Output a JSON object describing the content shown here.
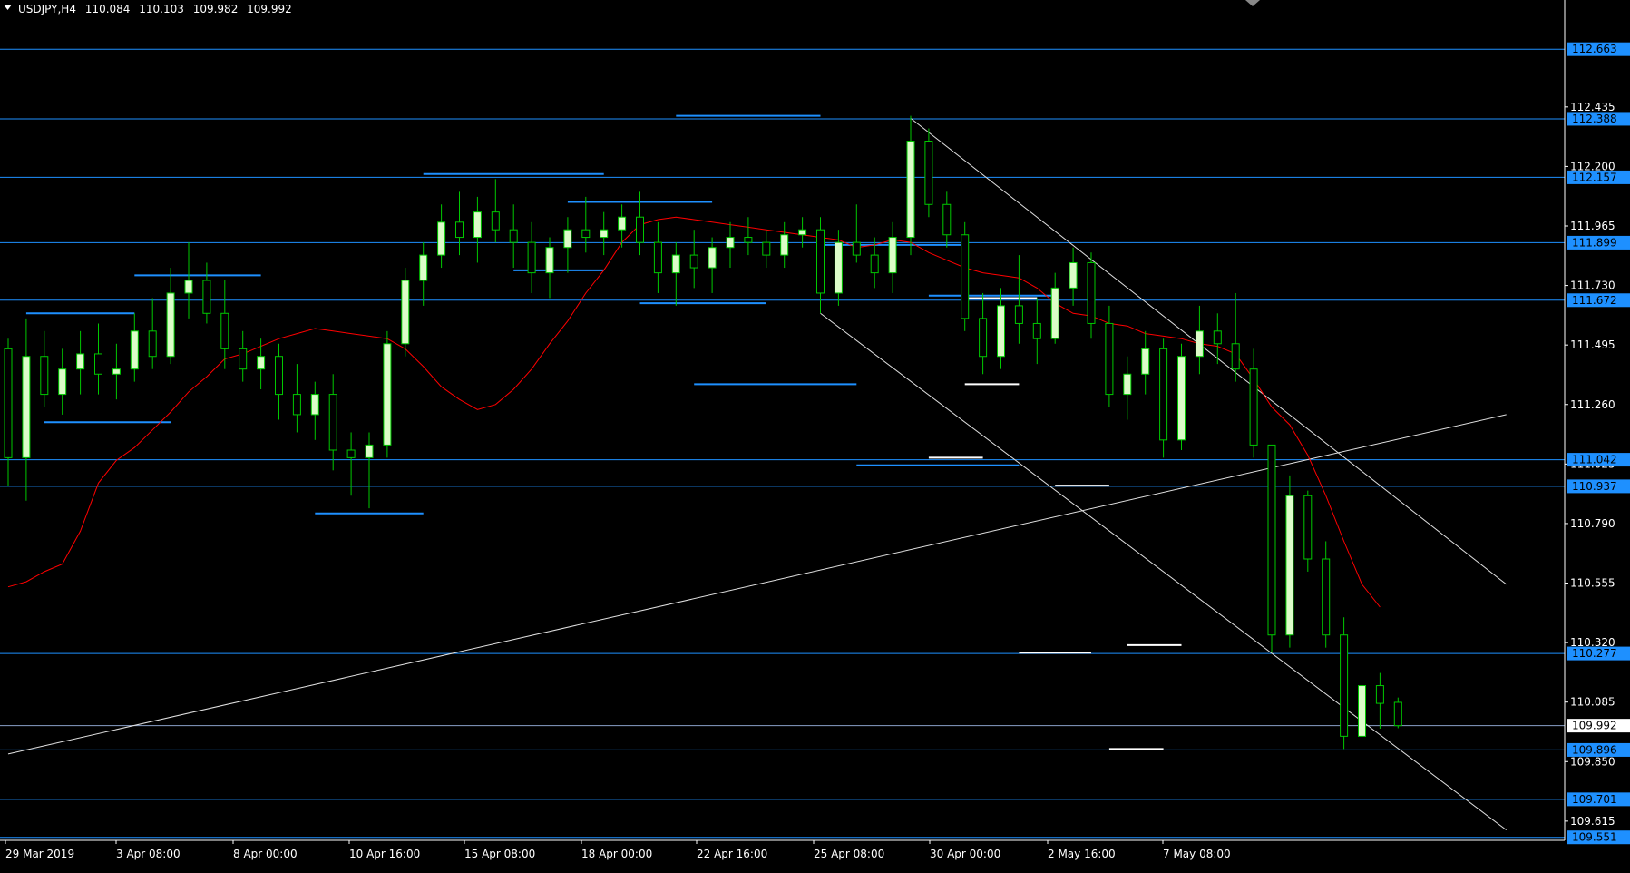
{
  "chart_data": {
    "type": "candlestick",
    "title": "USDJPY,H4",
    "ohlc_header": [
      "110.084",
      "110.103",
      "109.982",
      "109.992"
    ],
    "y_ticks": [
      "112.435",
      "112.200",
      "111.965",
      "111.730",
      "111.495",
      "111.260",
      "111.025",
      "110.790",
      "110.555",
      "110.320",
      "110.085",
      "109.850",
      "109.615"
    ],
    "x_ticks": [
      "29 Mar 2019",
      "3 Apr 08:00",
      "8 Apr 00:00",
      "10 Apr 16:00",
      "15 Apr 08:00",
      "18 Apr 00:00",
      "22 Apr 16:00",
      "25 Apr 08:00",
      "30 Apr 00:00",
      "2 May 16:00",
      "7 May 08:00"
    ],
    "ylim": [
      109.55,
      112.85
    ],
    "grid": false,
    "colors": {
      "background": "#000000",
      "up_body": "#dcfcc8",
      "down_body": "#000000",
      "wick": "#00c800",
      "level_line": "#1e90ff",
      "level_tag": "#1e90ff",
      "current_tag": "#ffffff",
      "ma": "#ff0000",
      "trendline": "#e0e0e0",
      "segment_blue": "#1e90ff",
      "segment_white": "#ffffff"
    },
    "horizontal_levels": [
      {
        "price": 112.663,
        "label": "112.663"
      },
      {
        "price": 112.388,
        "label": "112.388"
      },
      {
        "price": 112.157,
        "label": "112.157"
      },
      {
        "price": 111.899,
        "label": "111.899"
      },
      {
        "price": 111.672,
        "label": "111.672"
      },
      {
        "price": 111.042,
        "label": "111.042"
      },
      {
        "price": 110.937,
        "label": "110.937"
      },
      {
        "price": 110.277,
        "label": "110.277"
      },
      {
        "price": 109.896,
        "label": "109.896"
      },
      {
        "price": 109.701,
        "label": "109.701"
      },
      {
        "price": 109.551,
        "label": "109.551"
      }
    ],
    "current_price": {
      "price": 109.992,
      "label": "109.992"
    },
    "moving_average": [
      [
        0,
        110.54
      ],
      [
        1,
        110.56
      ],
      [
        2,
        110.6
      ],
      [
        3,
        110.63
      ],
      [
        4,
        110.76
      ],
      [
        5,
        110.95
      ],
      [
        6,
        111.04
      ],
      [
        7,
        111.09
      ],
      [
        8,
        111.16
      ],
      [
        9,
        111.23
      ],
      [
        10,
        111.31
      ],
      [
        11,
        111.37
      ],
      [
        12,
        111.44
      ],
      [
        13,
        111.46
      ],
      [
        14,
        111.49
      ],
      [
        15,
        111.52
      ],
      [
        16,
        111.54
      ],
      [
        17,
        111.56
      ],
      [
        18,
        111.55
      ],
      [
        19,
        111.54
      ],
      [
        20,
        111.53
      ],
      [
        21,
        111.52
      ],
      [
        22,
        111.48
      ],
      [
        23,
        111.41
      ],
      [
        24,
        111.33
      ],
      [
        25,
        111.28
      ],
      [
        26,
        111.24
      ],
      [
        27,
        111.26
      ],
      [
        28,
        111.32
      ],
      [
        29,
        111.4
      ],
      [
        30,
        111.5
      ],
      [
        31,
        111.59
      ],
      [
        32,
        111.7
      ],
      [
        33,
        111.79
      ],
      [
        34,
        111.9
      ],
      [
        35,
        111.97
      ],
      [
        36,
        111.99
      ],
      [
        37,
        112.0
      ],
      [
        38,
        111.99
      ],
      [
        39,
        111.98
      ],
      [
        40,
        111.97
      ],
      [
        41,
        111.96
      ],
      [
        42,
        111.95
      ],
      [
        43,
        111.94
      ],
      [
        44,
        111.93
      ],
      [
        45,
        111.92
      ],
      [
        46,
        111.91
      ],
      [
        47,
        111.88
      ],
      [
        48,
        111.89
      ],
      [
        49,
        111.91
      ],
      [
        50,
        111.9
      ],
      [
        51,
        111.86
      ],
      [
        52,
        111.83
      ],
      [
        53,
        111.8
      ],
      [
        54,
        111.78
      ],
      [
        55,
        111.77
      ],
      [
        56,
        111.76
      ],
      [
        57,
        111.72
      ],
      [
        58,
        111.66
      ],
      [
        59,
        111.62
      ],
      [
        60,
        111.61
      ],
      [
        61,
        111.58
      ],
      [
        62,
        111.57
      ],
      [
        63,
        111.54
      ],
      [
        64,
        111.53
      ],
      [
        65,
        111.52
      ],
      [
        66,
        111.5
      ],
      [
        67,
        111.49
      ],
      [
        68,
        111.46
      ],
      [
        69,
        111.36
      ],
      [
        70,
        111.25
      ],
      [
        71,
        111.18
      ],
      [
        72,
        111.06
      ],
      [
        73,
        110.9
      ],
      [
        74,
        110.72
      ],
      [
        75,
        110.55
      ],
      [
        76,
        110.46
      ]
    ],
    "candles": [
      [
        111.48,
        111.52,
        110.94,
        111.05
      ],
      [
        111.05,
        111.6,
        110.88,
        111.45
      ],
      [
        111.45,
        111.55,
        111.25,
        111.3
      ],
      [
        111.3,
        111.48,
        111.22,
        111.4
      ],
      [
        111.4,
        111.55,
        111.3,
        111.46
      ],
      [
        111.46,
        111.58,
        111.3,
        111.38
      ],
      [
        111.38,
        111.5,
        111.28,
        111.4
      ],
      [
        111.4,
        111.62,
        111.35,
        111.55
      ],
      [
        111.55,
        111.68,
        111.4,
        111.45
      ],
      [
        111.45,
        111.8,
        111.42,
        111.7
      ],
      [
        111.7,
        111.9,
        111.6,
        111.75
      ],
      [
        111.75,
        111.82,
        111.58,
        111.62
      ],
      [
        111.62,
        111.75,
        111.4,
        111.48
      ],
      [
        111.48,
        111.55,
        111.35,
        111.4
      ],
      [
        111.4,
        111.52,
        111.32,
        111.45
      ],
      [
        111.45,
        111.5,
        111.2,
        111.3
      ],
      [
        111.3,
        111.42,
        111.15,
        111.22
      ],
      [
        111.22,
        111.35,
        111.12,
        111.3
      ],
      [
        111.3,
        111.38,
        111.0,
        111.08
      ],
      [
        111.08,
        111.15,
        110.9,
        111.05
      ],
      [
        111.05,
        111.15,
        110.85,
        111.1
      ],
      [
        111.1,
        111.55,
        111.05,
        111.5
      ],
      [
        111.5,
        111.8,
        111.45,
        111.75
      ],
      [
        111.75,
        111.9,
        111.65,
        111.85
      ],
      [
        111.85,
        112.05,
        111.8,
        111.98
      ],
      [
        111.98,
        112.1,
        111.85,
        111.92
      ],
      [
        111.92,
        112.08,
        111.82,
        112.02
      ],
      [
        112.02,
        112.15,
        111.9,
        111.95
      ],
      [
        111.95,
        112.05,
        111.8,
        111.9
      ],
      [
        111.9,
        111.98,
        111.7,
        111.78
      ],
      [
        111.78,
        111.92,
        111.68,
        111.88
      ],
      [
        111.88,
        112.0,
        111.78,
        111.95
      ],
      [
        111.95,
        112.08,
        111.86,
        111.92
      ],
      [
        111.92,
        112.02,
        111.85,
        111.95
      ],
      [
        111.95,
        112.05,
        111.88,
        112.0
      ],
      [
        112.0,
        112.1,
        111.85,
        111.9
      ],
      [
        111.9,
        111.98,
        111.7,
        111.78
      ],
      [
        111.78,
        111.9,
        111.65,
        111.85
      ],
      [
        111.85,
        111.95,
        111.72,
        111.8
      ],
      [
        111.8,
        111.92,
        111.7,
        111.88
      ],
      [
        111.88,
        111.98,
        111.8,
        111.92
      ],
      [
        111.92,
        112.0,
        111.85,
        111.9
      ],
      [
        111.9,
        111.95,
        111.8,
        111.85
      ],
      [
        111.85,
        111.98,
        111.8,
        111.93
      ],
      [
        111.93,
        112.0,
        111.88,
        111.95
      ],
      [
        111.95,
        112.0,
        111.62,
        111.7
      ],
      [
        111.7,
        111.95,
        111.65,
        111.9
      ],
      [
        111.9,
        112.05,
        111.82,
        111.85
      ],
      [
        111.85,
        111.92,
        111.72,
        111.78
      ],
      [
        111.78,
        111.98,
        111.7,
        111.92
      ],
      [
        111.92,
        112.4,
        111.85,
        112.3
      ],
      [
        112.3,
        112.35,
        112.0,
        112.05
      ],
      [
        112.05,
        112.1,
        111.88,
        111.93
      ],
      [
        111.93,
        111.98,
        111.55,
        111.6
      ],
      [
        111.6,
        111.7,
        111.38,
        111.45
      ],
      [
        111.45,
        111.72,
        111.4,
        111.65
      ],
      [
        111.65,
        111.85,
        111.5,
        111.58
      ],
      [
        111.58,
        111.68,
        111.42,
        111.52
      ],
      [
        111.52,
        111.78,
        111.5,
        111.72
      ],
      [
        111.72,
        111.88,
        111.65,
        111.82
      ],
      [
        111.82,
        111.86,
        111.52,
        111.58
      ],
      [
        111.58,
        111.65,
        111.25,
        111.3
      ],
      [
        111.3,
        111.45,
        111.2,
        111.38
      ],
      [
        111.38,
        111.55,
        111.3,
        111.48
      ],
      [
        111.48,
        111.52,
        111.05,
        111.12
      ],
      [
        111.12,
        111.5,
        111.08,
        111.45
      ],
      [
        111.45,
        111.65,
        111.38,
        111.55
      ],
      [
        111.55,
        111.62,
        111.42,
        111.5
      ],
      [
        111.5,
        111.7,
        111.35,
        111.4
      ],
      [
        111.4,
        111.48,
        111.05,
        111.1
      ],
      [
        111.1,
        110.95,
        110.28,
        110.35
      ],
      [
        110.35,
        110.98,
        110.3,
        110.9
      ],
      [
        110.9,
        110.92,
        110.6,
        110.65
      ],
      [
        110.65,
        110.72,
        110.3,
        110.35
      ],
      [
        110.35,
        110.42,
        109.9,
        109.95
      ],
      [
        109.95,
        110.25,
        109.9,
        110.15
      ],
      [
        110.15,
        110.2,
        109.98,
        110.08
      ],
      [
        110.084,
        110.103,
        109.982,
        109.992
      ]
    ],
    "trendlines": [
      {
        "from": [
          0,
          109.88
        ],
        "to": [
          83,
          111.22
        ]
      },
      {
        "from": [
          50,
          112.39
        ],
        "to": [
          83,
          110.55
        ]
      },
      {
        "from": [
          45,
          111.62
        ],
        "to": [
          83,
          109.58
        ]
      }
    ],
    "segments": [
      {
        "price": 111.62,
        "from": 1,
        "to": 7,
        "color": "blue"
      },
      {
        "price": 111.19,
        "from": 2,
        "to": 9,
        "color": "blue"
      },
      {
        "price": 111.77,
        "from": 7,
        "to": 14,
        "color": "blue"
      },
      {
        "price": 110.83,
        "from": 17,
        "to": 23,
        "color": "blue"
      },
      {
        "price": 112.17,
        "from": 23,
        "to": 33,
        "color": "blue"
      },
      {
        "price": 111.79,
        "from": 28,
        "to": 33,
        "color": "blue"
      },
      {
        "price": 112.06,
        "from": 31,
        "to": 39,
        "color": "blue"
      },
      {
        "price": 111.66,
        "from": 35,
        "to": 42,
        "color": "blue"
      },
      {
        "price": 112.4,
        "from": 37,
        "to": 45,
        "color": "blue"
      },
      {
        "price": 111.34,
        "from": 38,
        "to": 47,
        "color": "blue"
      },
      {
        "price": 111.89,
        "from": 45,
        "to": 53,
        "color": "blue"
      },
      {
        "price": 111.69,
        "from": 51,
        "to": 58,
        "color": "blue"
      },
      {
        "price": 111.02,
        "from": 47,
        "to": 56,
        "color": "blue"
      },
      {
        "price": 111.68,
        "from": 53,
        "to": 57,
        "color": "white"
      },
      {
        "price": 111.34,
        "from": 53,
        "to": 56,
        "color": "white"
      },
      {
        "price": 111.05,
        "from": 51,
        "to": 54,
        "color": "white"
      },
      {
        "price": 110.94,
        "from": 58,
        "to": 61,
        "color": "white"
      },
      {
        "price": 110.28,
        "from": 56,
        "to": 60,
        "color": "white"
      },
      {
        "price": 110.31,
        "from": 62,
        "to": 65,
        "color": "white"
      },
      {
        "price": 109.9,
        "from": 61,
        "to": 64,
        "color": "white"
      }
    ]
  }
}
